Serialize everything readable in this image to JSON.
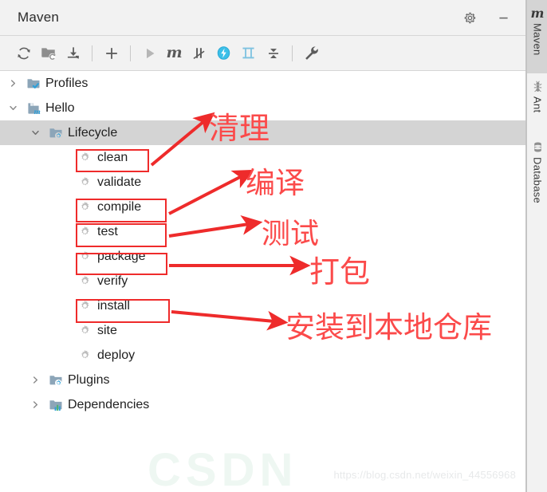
{
  "window": {
    "title": "Maven",
    "settings_icon": "gear-icon",
    "minimize_icon": "minimize-icon"
  },
  "toolbar": {
    "items": [
      {
        "name": "reimport-button",
        "icon": "refresh-icon",
        "label": "Reimport All Maven Projects"
      },
      {
        "name": "generate-sources-button",
        "icon": "folder-refresh-icon",
        "label": "Generate Sources and Update Folders"
      },
      {
        "name": "download-sources-button",
        "icon": "download-icon",
        "label": "Download Sources and/or Documentation"
      },
      {
        "name": "add-maven-project-button",
        "icon": "plus-icon",
        "label": "Add Maven Projects"
      },
      {
        "name": "run-build-button",
        "icon": "play-icon",
        "label": "Run Maven Build"
      },
      {
        "name": "execute-goal-button",
        "icon": "maven-m-icon",
        "label": "Execute Maven Goal"
      },
      {
        "name": "toggle-offline-button",
        "icon": "offline-icon",
        "label": "Toggle Offline Mode"
      },
      {
        "name": "toggle-skip-tests-button",
        "icon": "skip-tests-icon",
        "label": "Skip Tests"
      },
      {
        "name": "show-dependencies-button",
        "icon": "dependencies-icon",
        "label": "Show Dependencies"
      },
      {
        "name": "collapse-all-button",
        "icon": "collapse-all-icon",
        "label": "Collapse All"
      },
      {
        "name": "maven-settings-button",
        "icon": "wrench-icon",
        "label": "Maven Settings"
      }
    ]
  },
  "tree": {
    "nodes": [
      {
        "name": "profiles",
        "label": "Profiles",
        "level": 0,
        "twisty": "collapsed",
        "icon": "profiles-icon",
        "selected": false
      },
      {
        "name": "hello",
        "label": "Hello",
        "level": 0,
        "twisty": "expanded",
        "icon": "maven-project-icon",
        "selected": false
      },
      {
        "name": "lifecycle",
        "label": "Lifecycle",
        "level": 1,
        "twisty": "expanded",
        "icon": "lifecycle-icon",
        "selected": true
      },
      {
        "name": "goal-clean",
        "label": "clean",
        "level": 2,
        "twisty": "none",
        "icon": "goal-icon",
        "selected": false
      },
      {
        "name": "goal-validate",
        "label": "validate",
        "level": 2,
        "twisty": "none",
        "icon": "goal-icon",
        "selected": false
      },
      {
        "name": "goal-compile",
        "label": "compile",
        "level": 2,
        "twisty": "none",
        "icon": "goal-icon",
        "selected": false
      },
      {
        "name": "goal-test",
        "label": "test",
        "level": 2,
        "twisty": "none",
        "icon": "goal-icon",
        "selected": false
      },
      {
        "name": "goal-package",
        "label": "package",
        "level": 2,
        "twisty": "none",
        "icon": "goal-icon",
        "selected": false
      },
      {
        "name": "goal-verify",
        "label": "verify",
        "level": 2,
        "twisty": "none",
        "icon": "goal-icon",
        "selected": false
      },
      {
        "name": "goal-install",
        "label": "install",
        "level": 2,
        "twisty": "none",
        "icon": "goal-icon",
        "selected": false
      },
      {
        "name": "goal-site",
        "label": "site",
        "level": 2,
        "twisty": "none",
        "icon": "goal-icon",
        "selected": false
      },
      {
        "name": "goal-deploy",
        "label": "deploy",
        "level": 2,
        "twisty": "none",
        "icon": "goal-icon",
        "selected": false
      },
      {
        "name": "plugins",
        "label": "Plugins",
        "level": 1,
        "twisty": "collapsed",
        "icon": "plugins-icon",
        "selected": false
      },
      {
        "name": "dependencies",
        "label": "Dependencies",
        "level": 1,
        "twisty": "collapsed",
        "icon": "dependencies-icon",
        "selected": false
      }
    ]
  },
  "annotations": {
    "accent_color": "#ef2b2b",
    "text_color": "#fb4a4a",
    "labels": [
      {
        "name": "annotation-clean",
        "text": "清理",
        "target": "clean"
      },
      {
        "name": "annotation-compile",
        "text": "编译",
        "target": "compile"
      },
      {
        "name": "annotation-test",
        "text": "测试",
        "target": "test"
      },
      {
        "name": "annotation-package",
        "text": "打包",
        "target": "package"
      },
      {
        "name": "annotation-install",
        "text": "安装到本地仓库",
        "target": "install"
      }
    ],
    "boxed_goals": [
      "clean",
      "compile",
      "test",
      "package",
      "install"
    ]
  },
  "right_tabs": [
    {
      "name": "tab-maven",
      "label": "Maven",
      "icon": "maven-m-icon",
      "active": true
    },
    {
      "name": "tab-ant",
      "label": "Ant",
      "icon": "ant-icon",
      "active": false
    },
    {
      "name": "tab-database",
      "label": "Database",
      "icon": "database-icon",
      "active": false
    }
  ],
  "watermark": {
    "url": "https://blog.csdn.net/weixin_44556968",
    "logo_text": "CSDN"
  }
}
